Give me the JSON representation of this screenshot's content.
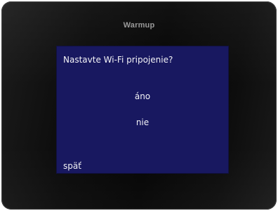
{
  "device": {
    "brand": "Warmup"
  },
  "screen": {
    "title": "Nastavte Wi-Fi pripojenie?",
    "options": [
      {
        "label": "áno"
      },
      {
        "label": "nie"
      }
    ],
    "back_label": "späť"
  },
  "colors": {
    "screen_background": "#181860",
    "text": "#f2f2f6",
    "bezel": "#0a0a0a"
  }
}
